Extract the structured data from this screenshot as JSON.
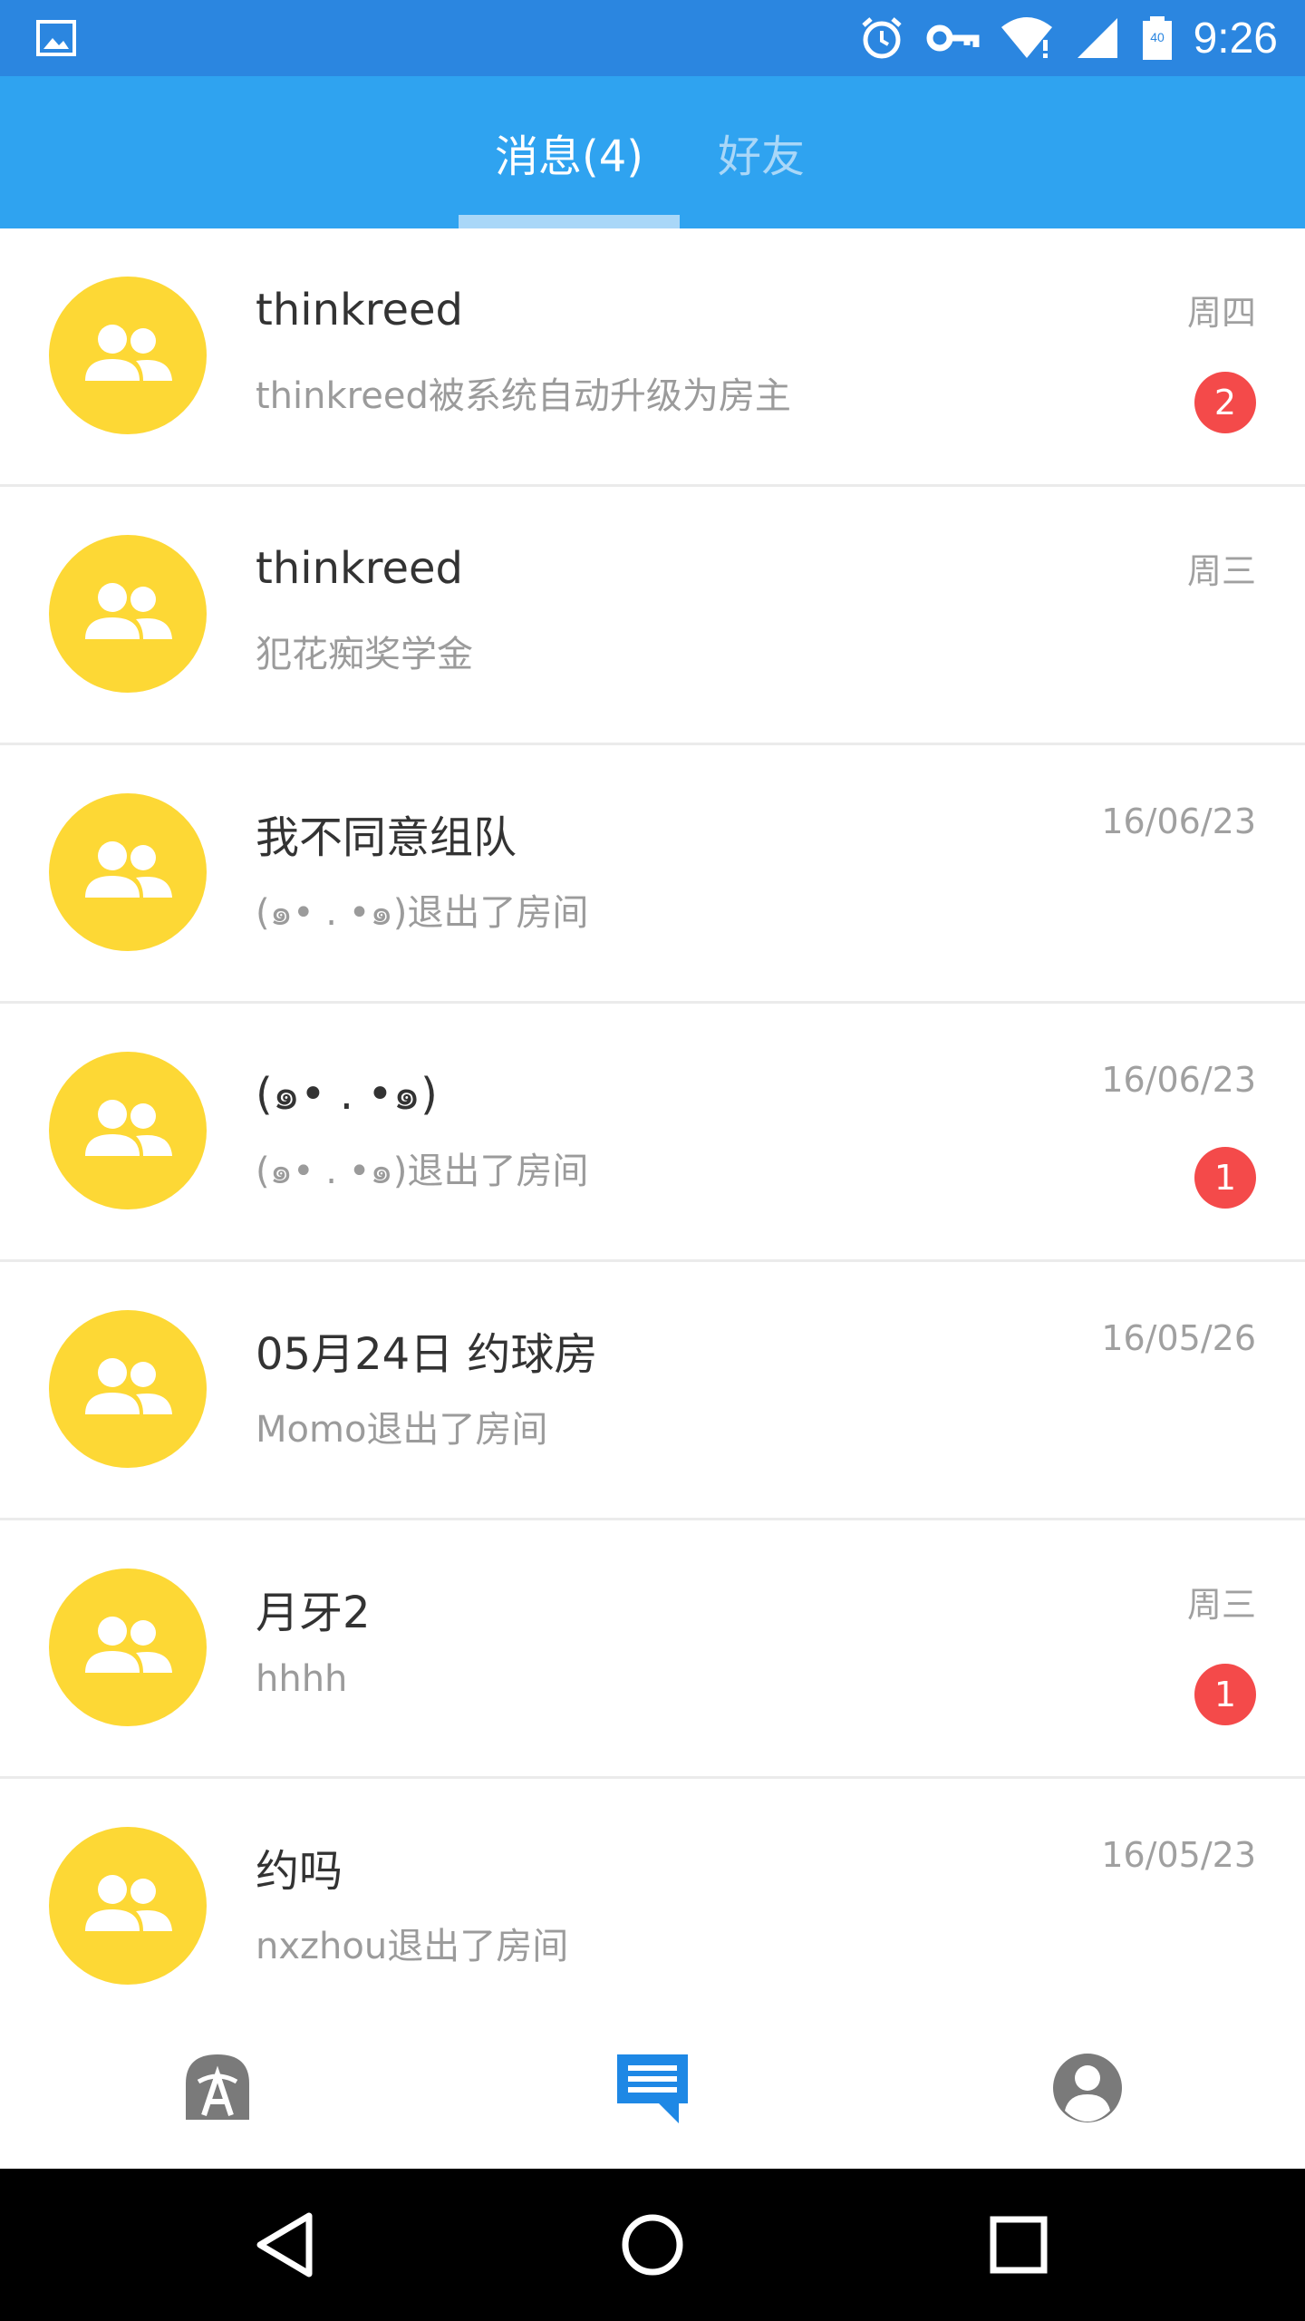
{
  "status_bar": {
    "time": "9:26",
    "icons": [
      "gallery-icon",
      "alarm-icon",
      "vpn-key-icon",
      "wifi-icon",
      "signal-icon",
      "battery-icon"
    ],
    "battery_label": "40"
  },
  "tabs": [
    {
      "label": "消息(4)",
      "active": true
    },
    {
      "label": "好友",
      "active": false
    }
  ],
  "conversations": [
    {
      "title": "thinkreed",
      "subtitle": "thinkreed被系统自动升级为房主",
      "date": "周四",
      "badge": "2"
    },
    {
      "title": "thinkreed",
      "subtitle": "犯花痴奖学金",
      "date": "周三",
      "badge": ""
    },
    {
      "title": "我不同意组队",
      "subtitle": "(๑• . •๑)退出了房间",
      "date": "16/06/23",
      "badge": ""
    },
    {
      "title": "(๑• . •๑)",
      "subtitle": "(๑• . •๑)退出了房间",
      "date": "16/06/23",
      "badge": "1"
    },
    {
      "title": "05月24日 约球房",
      "subtitle": "Momo退出了房间",
      "date": "16/05/26",
      "badge": ""
    },
    {
      "title": "月牙2",
      "subtitle": "hhhh",
      "date": "周三",
      "badge": "1"
    },
    {
      "title": "约吗",
      "subtitle": "nxzhou退出了房间",
      "date": "16/05/23",
      "badge": ""
    }
  ],
  "bottom_nav": {
    "items": [
      "home-icon",
      "messages-icon",
      "profile-icon"
    ],
    "active_index": 1,
    "active_color": "#1e88e5",
    "inactive_color": "#7a7a7a"
  },
  "colors": {
    "status_bar": "#2b86e0",
    "header": "#2fa3f0",
    "avatar": "#fdd835",
    "badge": "#f44a4a"
  }
}
